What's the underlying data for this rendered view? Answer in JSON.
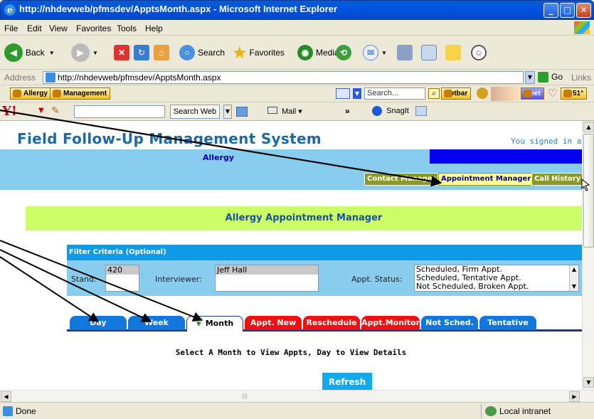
{
  "window": {
    "title": "http://nhdevweb/pfmsdev/ApptsMonth.aspx - Microsoft Internet Explorer"
  },
  "menu": [
    "File",
    "Edit",
    "View",
    "Favorites",
    "Tools",
    "Help"
  ],
  "toolbar": {
    "back": "Back",
    "search": "Search",
    "favorites": "Favorites",
    "media": "Media"
  },
  "address": {
    "label": "Address",
    "url": "http://nhdevweb/pfmsdev/ApptsMonth.aspx",
    "go": "Go",
    "links": "Links"
  },
  "links_bar": {
    "allergy": "Allergy",
    "management": "Management",
    "search_placeholder": "Search...",
    "hotbar": "Hotbar",
    "meet": "Meet",
    "temp": "51°"
  },
  "yahoo_bar": {
    "search_web": "Search Web",
    "mail": "Mail",
    "more": "»",
    "snagit": "SnagIt"
  },
  "page": {
    "system_name": "Field Follow-Up Management System",
    "signed_in": "You signed in as",
    "dept": "Allergy",
    "nav": [
      "Contact Manager",
      "Appointment Manager",
      "Call History"
    ],
    "title": "Allergy Appointment Manager",
    "filter": {
      "header": "Filter Criteria (Optional)",
      "stand_label": "Stand:",
      "stand_values": [
        "420"
      ],
      "interviewer_label": "Interviewer:",
      "interviewer_values": [
        "Jeff Hall"
      ],
      "status_label": "Appt. Status:",
      "status_values": [
        "Scheduled, Firm Appt.",
        "Scheduled, Tentative Appt.",
        "Not Scheduled, Broken Appt."
      ]
    },
    "tabs": [
      "Day",
      "Week",
      "Month",
      "Appt. New",
      "Reschedule",
      "Appt.Monitor",
      "Not Sched.",
      "Tentative"
    ],
    "active_tab": "Month",
    "select_message": "Select A Month to View Appts, Day to View Details",
    "refresh": "Refresh"
  },
  "status": {
    "left": "Done",
    "zone": "Local intranet"
  },
  "colors": {
    "accent_blue": "#0e9ae6",
    "light_blue": "#88ccee",
    "lime": "#ccff66",
    "red_tab": "#ee1111",
    "blue_tab": "#1177dd",
    "nav_olive": "#8a9a2a"
  }
}
